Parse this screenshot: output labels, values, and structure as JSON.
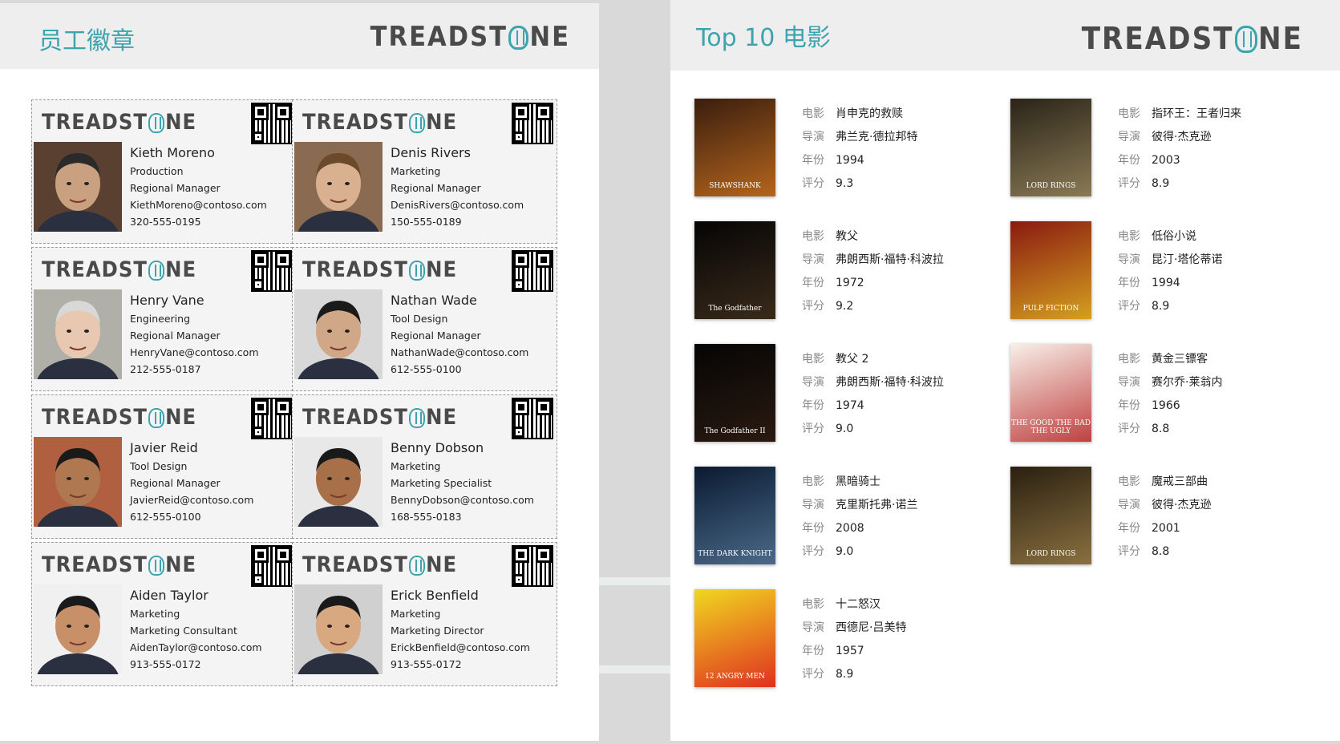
{
  "left_panel": {
    "title": "员工徽章",
    "brand": {
      "pre": "TREADST",
      "post": "NE"
    }
  },
  "right_panel": {
    "title": "Top 10 电影",
    "brand": {
      "pre": "TREADST",
      "post": "NE"
    }
  },
  "badges": [
    {
      "name": "Kieth Moreno",
      "dept": "Production",
      "role": "Regional Manager",
      "email": "KiethMoreno@contoso.com",
      "phone": "320-555-0195"
    },
    {
      "name": "Denis Rivers",
      "dept": "Marketing",
      "role": "Regional Manager",
      "email": "DenisRivers@contoso.com",
      "phone": "150-555-0189"
    },
    {
      "name": "Henry Vane",
      "dept": "Engineering",
      "role": "Regional Manager",
      "email": "HenryVane@contoso.com",
      "phone": "212-555-0187"
    },
    {
      "name": "Nathan Wade",
      "dept": "Tool Design",
      "role": "Regional Manager",
      "email": "NathanWade@contoso.com",
      "phone": "612-555-0100"
    },
    {
      "name": "Javier Reid",
      "dept": "Tool Design",
      "role": "Regional Manager",
      "email": "JavierReid@contoso.com",
      "phone": "612-555-0100"
    },
    {
      "name": "Benny Dobson",
      "dept": "Marketing",
      "role": "Marketing Specialist",
      "email": "BennyDobson@contoso.com",
      "phone": "168-555-0183"
    },
    {
      "name": "Aiden Taylor",
      "dept": "Marketing",
      "role": "Marketing Consultant",
      "email": "AidenTaylor@contoso.com",
      "phone": "913-555-0172"
    },
    {
      "name": "Erick Benfield",
      "dept": "Marketing",
      "role": "Marketing Director",
      "email": "ErickBenfield@contoso.com",
      "phone": "913-555-0172"
    }
  ],
  "movie_labels": {
    "title": "电影",
    "director": "导演",
    "year": "年份",
    "rating": "评分"
  },
  "movies": [
    {
      "title": "肖申克的救赎",
      "director": "弗兰克·德拉邦特",
      "year": "1994",
      "rating": "9.3",
      "poster_text": "SHAWSHANK",
      "colors": [
        "#3a1e0e",
        "#b5651d"
      ]
    },
    {
      "title": "指环王：王者归来",
      "director": "彼得·杰克逊",
      "year": "2003",
      "rating": "8.9",
      "poster_text": "LORD RINGS",
      "colors": [
        "#2a2418",
        "#8a7a55"
      ]
    },
    {
      "title": "教父",
      "director": "弗朗西斯·福特·科波拉",
      "year": "1972",
      "rating": "9.2",
      "poster_text": "The Godfather",
      "colors": [
        "#050505",
        "#3a2a1a"
      ]
    },
    {
      "title": "低俗小说",
      "director": "昆汀·塔伦蒂诺",
      "year": "1994",
      "rating": "8.9",
      "poster_text": "PULP FICTION",
      "colors": [
        "#8a1a10",
        "#d4a020"
      ]
    },
    {
      "title": "教父 2",
      "director": "弗朗西斯·福特·科波拉",
      "year": "1974",
      "rating": "9.0",
      "poster_text": "The Godfather II",
      "colors": [
        "#050505",
        "#2a1a10"
      ]
    },
    {
      "title": "黄金三镖客",
      "director": "赛尔乔·莱翁内",
      "year": "1966",
      "rating": "8.8",
      "poster_text": "THE GOOD THE BAD THE UGLY",
      "colors": [
        "#f8f0e8",
        "#c04040"
      ]
    },
    {
      "title": "黑暗骑士",
      "director": "克里斯托弗·诺兰",
      "year": "2008",
      "rating": "9.0",
      "poster_text": "THE DARK KNIGHT",
      "colors": [
        "#0a1a30",
        "#4a6a8a"
      ]
    },
    {
      "title": "魔戒三部曲",
      "director": "彼得·杰克逊",
      "year": "2001",
      "rating": "8.8",
      "poster_text": "LORD RINGS",
      "colors": [
        "#2a2010",
        "#8a7040"
      ]
    },
    {
      "title": "十二怒汉",
      "director": "西德尼·吕美特",
      "year": "1957",
      "rating": "8.9",
      "poster_text": "12 ANGRY MEN",
      "colors": [
        "#f0d820",
        "#e03020"
      ]
    }
  ]
}
